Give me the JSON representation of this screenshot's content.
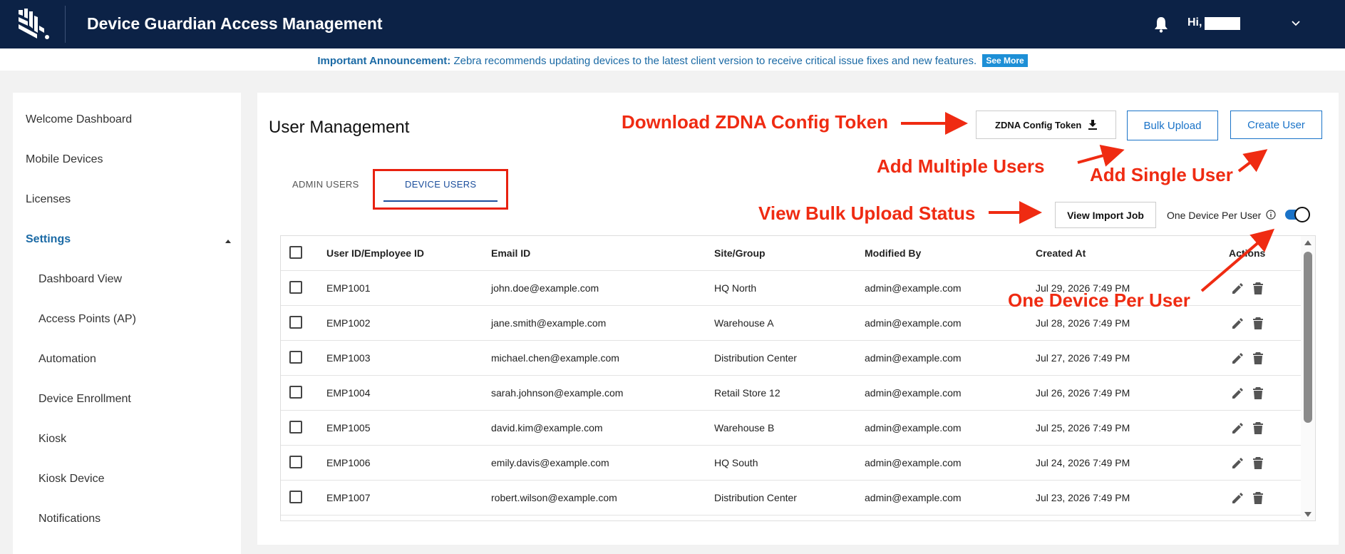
{
  "header": {
    "app_title": "Device Guardian Access Management",
    "greeting": "Hi,",
    "bg_color": "#0c2246"
  },
  "announcement": {
    "label": "Important Announcement:",
    "text": "Zebra recommends updating devices to the latest client version to receive critical issue fixes and new features.",
    "button": "See More"
  },
  "sidebar": {
    "items": [
      {
        "label": "Welcome Dashboard"
      },
      {
        "label": "Mobile Devices"
      },
      {
        "label": "Licenses"
      },
      {
        "label": "Settings",
        "active": true,
        "expanded": true
      },
      {
        "label": "Dashboard View",
        "sub": true
      },
      {
        "label": "Access Points (AP)",
        "sub": true
      },
      {
        "label": "Automation",
        "sub": true
      },
      {
        "label": "Device Enrollment",
        "sub": true
      },
      {
        "label": "Kiosk",
        "sub": true
      },
      {
        "label": "Kiosk Device",
        "sub": true
      },
      {
        "label": "Notifications",
        "sub": true
      }
    ]
  },
  "main": {
    "title": "User Management",
    "buttons": {
      "token": "ZDNA Config Token",
      "bulk_upload": "Bulk Upload",
      "create_user": "Create User",
      "view_import": "View Import Job"
    },
    "tabs": [
      {
        "label": "ADMIN USERS",
        "active": false
      },
      {
        "label": "DEVICE USERS",
        "active": true
      }
    ],
    "one_device_label": "One Device Per User",
    "one_device_enabled": true,
    "accent_color": "#1a73c8"
  },
  "table": {
    "columns": [
      "User ID/Employee ID",
      "Email ID",
      "Site/Group",
      "Modified By",
      "Created At",
      "Actions"
    ],
    "rows": [
      [
        "EMP1001",
        "john.doe@example.com",
        "HQ North",
        "admin@example.com",
        "Jul 29, 2026 7:49 PM"
      ],
      [
        "EMP1002",
        "jane.smith@example.com",
        "Warehouse A",
        "admin@example.com",
        "Jul 28, 2026 7:49 PM"
      ],
      [
        "EMP1003",
        "michael.chen@example.com",
        "Distribution Center",
        "admin@example.com",
        "Jul 27, 2026 7:49 PM"
      ],
      [
        "EMP1004",
        "sarah.johnson@example.com",
        "Retail Store 12",
        "admin@example.com",
        "Jul 26, 2026 7:49 PM"
      ],
      [
        "EMP1005",
        "david.kim@example.com",
        "Warehouse B",
        "admin@example.com",
        "Jul 25, 2026 7:49 PM"
      ],
      [
        "EMP1006",
        "emily.davis@example.com",
        "HQ South",
        "admin@example.com",
        "Jul 24, 2026 7:49 PM"
      ],
      [
        "EMP1007",
        "robert.wilson@example.com",
        "Distribution Center",
        "admin@example.com",
        "Jul 23, 2026 7:49 PM"
      ]
    ]
  },
  "annotations": {
    "download_token": "Download ZDNA Config Token",
    "add_multiple": "Add Multiple Users",
    "add_single": "Add Single User",
    "view_bulk_status": "View Bulk Upload Status",
    "one_device": "One Device Per User",
    "color": "#ef2b12"
  }
}
